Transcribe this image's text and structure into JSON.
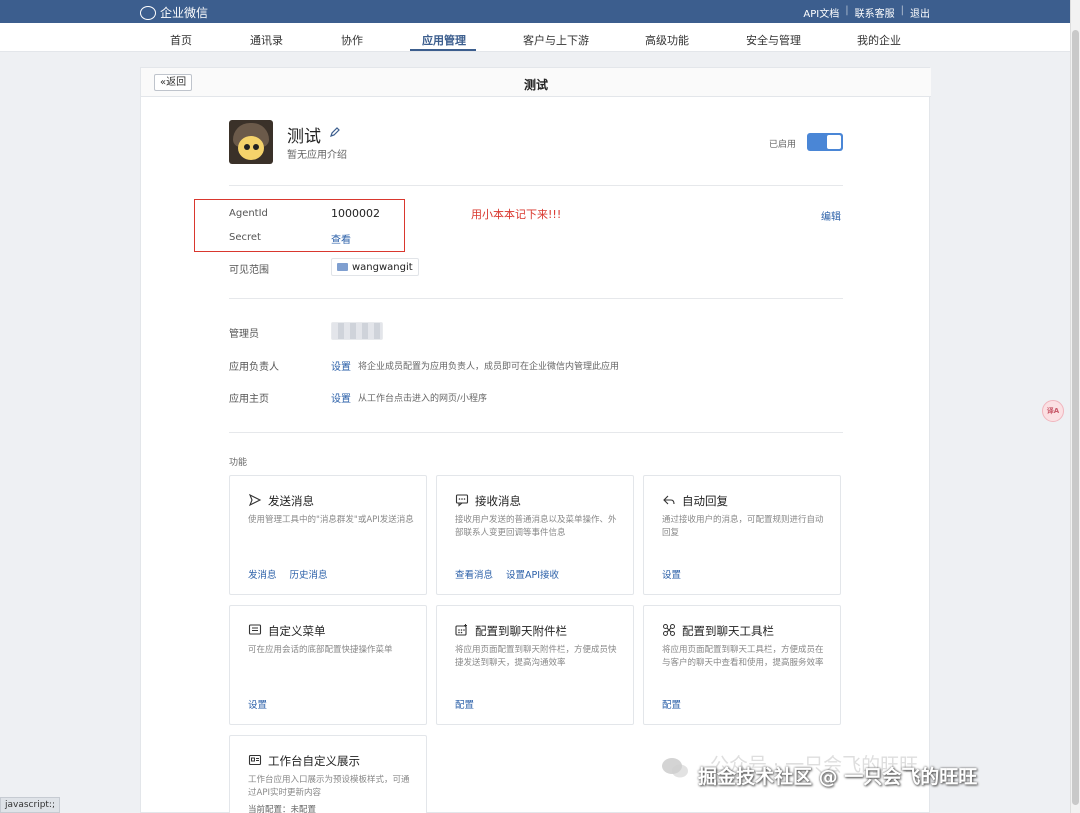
{
  "topbar": {
    "brand": "企业微信",
    "links": [
      "API文档",
      "联系客服",
      "退出"
    ],
    "separator": "|"
  },
  "nav": {
    "items": [
      "首页",
      "通讯录",
      "协作",
      "应用管理",
      "客户与上下游",
      "高级功能",
      "安全与管理",
      "我的企业"
    ],
    "active": "应用管理"
  },
  "header": {
    "back_label": "«返回",
    "title": "测试"
  },
  "app": {
    "name": "测试",
    "description": "暂无应用介绍",
    "status_label": "已启用",
    "enabled": true
  },
  "credentials": {
    "agentid_label": "AgentId",
    "agentid_value": "1000002",
    "secret_label": "Secret",
    "secret_link": "查看",
    "note": "用小本本记下来!!!",
    "edit_label": "编辑"
  },
  "scope": {
    "label": "可见范围",
    "value": "wangwangit"
  },
  "settings": {
    "admin_label": "管理员",
    "owner_label": "应用负责人",
    "owner_link": "设置",
    "owner_hint": "将企业成员配置为应用负责人，成员即可在企业微信内管理此应用",
    "homepage_label": "应用主页",
    "homepage_link": "设置",
    "homepage_hint": "从工作台点击进入的网页/小程序"
  },
  "features": {
    "section_label": "功能",
    "cards": [
      {
        "title": "发送消息",
        "icon": "send-icon",
        "desc": "使用管理工具中的\"消息群发\"或API发送消息",
        "actions": [
          "发消息",
          "历史消息"
        ]
      },
      {
        "title": "接收消息",
        "icon": "chat-icon",
        "desc": "接收用户发送的普通消息以及菜单操作、外部联系人变更回调等事件信息",
        "actions": [
          "查看消息",
          "设置API接收"
        ]
      },
      {
        "title": "自动回复",
        "icon": "reply-icon",
        "desc": "通过接收用户的消息，可配置规则进行自动回复",
        "actions": [
          "设置"
        ]
      },
      {
        "title": "自定义菜单",
        "icon": "menu-icon",
        "desc": "可在应用会话的底部配置快捷操作菜单",
        "actions": [
          "设置"
        ]
      },
      {
        "title": "配置到聊天附件栏",
        "icon": "attachment-grid-icon",
        "desc": "将应用页面配置到聊天附件栏，方便成员快捷发送到聊天，提高沟通效率",
        "actions": [
          "配置"
        ]
      },
      {
        "title": "配置到聊天工具栏",
        "icon": "toolbar-icon",
        "desc": "将应用页面配置到聊天工具栏，方便成员在与客户的聊天中查看和使用，提高服务效率",
        "actions": [
          "配置"
        ]
      },
      {
        "title": "工作台自定义展示",
        "icon": "workbench-icon",
        "desc": "工作台应用入口展示为预设模板样式，可通过API实时更新内容",
        "actions": [],
        "extra": "当前配置：未配置"
      }
    ]
  },
  "watermark": {
    "faint": "公众号 · 一只会飞的旺旺",
    "main": "掘金技术社区 @ 一只会飞的旺旺"
  },
  "statusbar": "javascript:;",
  "float_button": "译A"
}
